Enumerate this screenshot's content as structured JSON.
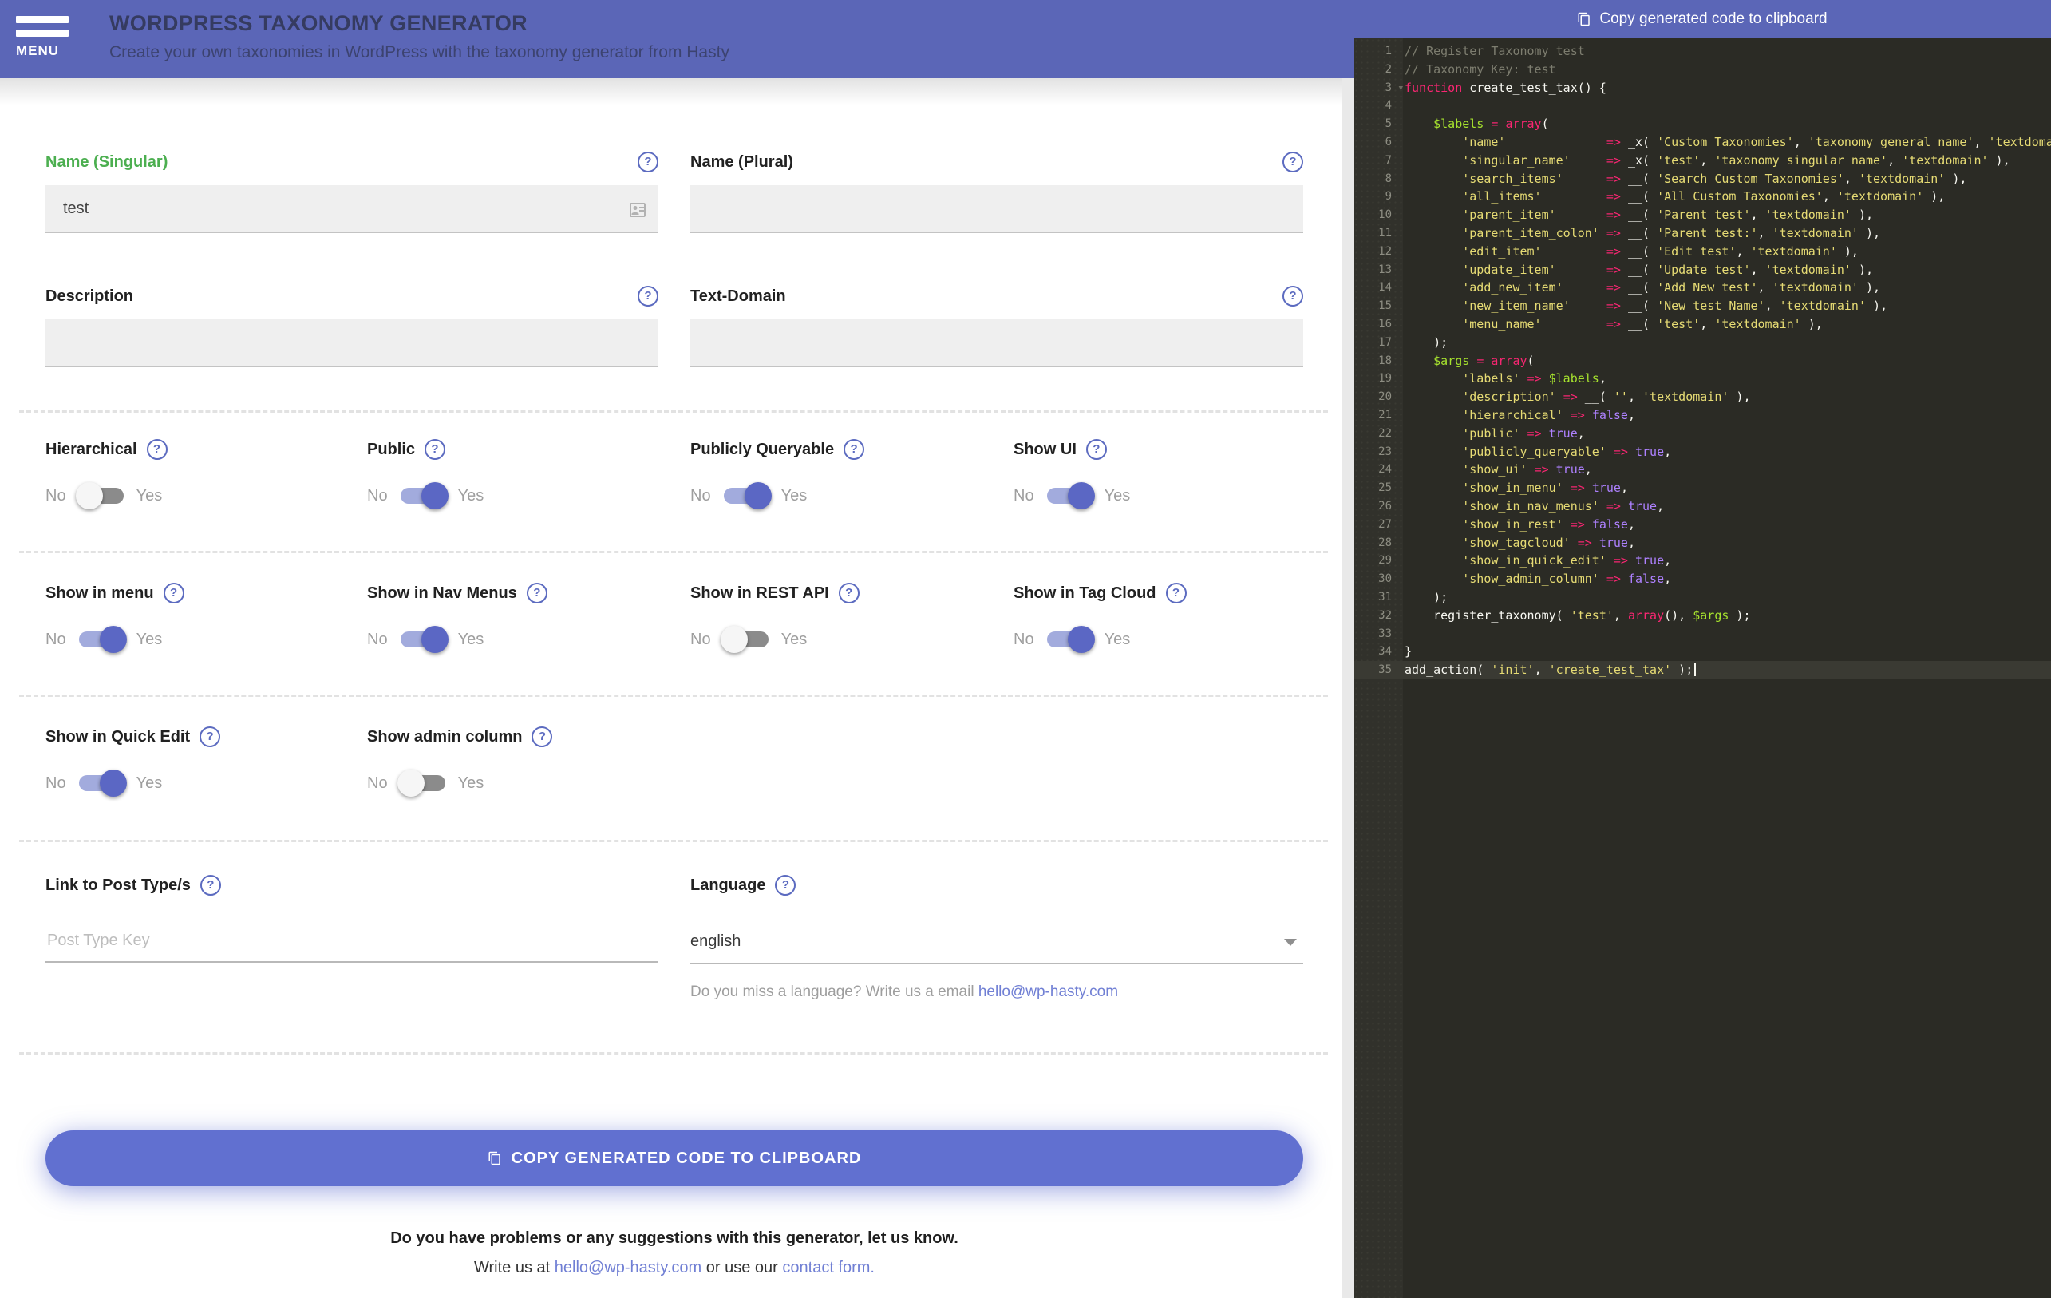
{
  "header": {
    "menu_label": "MENU",
    "title": "WORDPRESS TAXONOMY GENERATOR",
    "subtitle": "Create your own taxonomies in WordPress with the taxonomy generator from Hasty"
  },
  "form": {
    "fields": {
      "name_singular": {
        "label": "Name (Singular)",
        "value": "test"
      },
      "name_plural": {
        "label": "Name (Plural)",
        "value": ""
      },
      "description": {
        "label": "Description",
        "value": ""
      },
      "text_domain": {
        "label": "Text-Domain",
        "value": ""
      },
      "link_post_types": {
        "label": "Link to Post Type/s",
        "placeholder": "Post Type Key",
        "value": ""
      },
      "language": {
        "label": "Language",
        "value": "english",
        "helper_prefix": "Do you miss a language? Write us a email ",
        "helper_link": "hello@wp-hasty.com"
      }
    },
    "toggle_no": "No",
    "toggle_yes": "Yes",
    "toggles": [
      {
        "id": "hierarchical",
        "label": "Hierarchical",
        "state": "off"
      },
      {
        "id": "public",
        "label": "Public",
        "state": "on"
      },
      {
        "id": "publicly_queryable",
        "label": "Publicly Queryable",
        "state": "on"
      },
      {
        "id": "show_ui",
        "label": "Show UI",
        "state": "on"
      },
      {
        "id": "show_in_menu",
        "label": "Show in menu",
        "state": "on"
      },
      {
        "id": "show_in_nav_menus",
        "label": "Show in Nav Menus",
        "state": "on"
      },
      {
        "id": "show_in_rest_api",
        "label": "Show in REST API",
        "state": "off"
      },
      {
        "id": "show_in_tag_cloud",
        "label": "Show in Tag Cloud",
        "state": "on"
      },
      {
        "id": "show_in_quick_edit",
        "label": "Show in Quick Edit",
        "state": "on"
      },
      {
        "id": "show_admin_column",
        "label": "Show admin column",
        "state": "off"
      }
    ],
    "copy_button": "COPY GENERATED CODE TO CLIPBOARD"
  },
  "footer": {
    "line1": "Do you have problems or any suggestions with this generator, let us know.",
    "line2_prefix": "Write us at ",
    "line2_email": "hello@wp-hasty.com",
    "line2_middle": " or use our ",
    "line2_link": "contact form."
  },
  "code_panel": {
    "copy_label": "Copy generated code to clipboard",
    "current_line": 35,
    "fold_lines": [
      3
    ],
    "lines": [
      [
        [
          "cm",
          "// Register Taxonomy test"
        ]
      ],
      [
        [
          "cm",
          "// Taxonomy Key: test"
        ]
      ],
      [
        [
          "kw",
          "function"
        ],
        [
          "pl",
          " "
        ],
        [
          "fn",
          "create_test_tax"
        ],
        [
          "pl",
          "() {"
        ]
      ],
      [],
      [
        [
          "pl",
          "    "
        ],
        [
          "var",
          "$labels"
        ],
        [
          "pl",
          " "
        ],
        [
          "op",
          "="
        ],
        [
          "pl",
          " "
        ],
        [
          "op",
          "array"
        ],
        [
          "pl",
          "("
        ]
      ],
      [
        [
          "pl",
          "        "
        ],
        [
          "str",
          "'name'"
        ],
        [
          "pl",
          "              "
        ],
        [
          "op",
          "=>"
        ],
        [
          "pl",
          " "
        ],
        [
          "fn",
          "_x"
        ],
        [
          "pl",
          "( "
        ],
        [
          "str",
          "'Custom Taxonomies'"
        ],
        [
          "pl",
          ", "
        ],
        [
          "str",
          "'taxonomy general name'"
        ],
        [
          "pl",
          ", "
        ],
        [
          "str",
          "'textdomain'"
        ],
        [
          "pl",
          " ),"
        ]
      ],
      [
        [
          "pl",
          "        "
        ],
        [
          "str",
          "'singular_name'"
        ],
        [
          "pl",
          "     "
        ],
        [
          "op",
          "=>"
        ],
        [
          "pl",
          " "
        ],
        [
          "fn",
          "_x"
        ],
        [
          "pl",
          "( "
        ],
        [
          "str",
          "'test'"
        ],
        [
          "pl",
          ", "
        ],
        [
          "str",
          "'taxonomy singular name'"
        ],
        [
          "pl",
          ", "
        ],
        [
          "str",
          "'textdomain'"
        ],
        [
          "pl",
          " ),"
        ]
      ],
      [
        [
          "pl",
          "        "
        ],
        [
          "str",
          "'search_items'"
        ],
        [
          "pl",
          "      "
        ],
        [
          "op",
          "=>"
        ],
        [
          "pl",
          " "
        ],
        [
          "fn",
          "__"
        ],
        [
          "pl",
          "( "
        ],
        [
          "str",
          "'Search Custom Taxonomies'"
        ],
        [
          "pl",
          ", "
        ],
        [
          "str",
          "'textdomain'"
        ],
        [
          "pl",
          " ),"
        ]
      ],
      [
        [
          "pl",
          "        "
        ],
        [
          "str",
          "'all_items'"
        ],
        [
          "pl",
          "         "
        ],
        [
          "op",
          "=>"
        ],
        [
          "pl",
          " "
        ],
        [
          "fn",
          "__"
        ],
        [
          "pl",
          "( "
        ],
        [
          "str",
          "'All Custom Taxonomies'"
        ],
        [
          "pl",
          ", "
        ],
        [
          "str",
          "'textdomain'"
        ],
        [
          "pl",
          " ),"
        ]
      ],
      [
        [
          "pl",
          "        "
        ],
        [
          "str",
          "'parent_item'"
        ],
        [
          "pl",
          "       "
        ],
        [
          "op",
          "=>"
        ],
        [
          "pl",
          " "
        ],
        [
          "fn",
          "__"
        ],
        [
          "pl",
          "( "
        ],
        [
          "str",
          "'Parent test'"
        ],
        [
          "pl",
          ", "
        ],
        [
          "str",
          "'textdomain'"
        ],
        [
          "pl",
          " ),"
        ]
      ],
      [
        [
          "pl",
          "        "
        ],
        [
          "str",
          "'parent_item_colon'"
        ],
        [
          "pl",
          " "
        ],
        [
          "op",
          "=>"
        ],
        [
          "pl",
          " "
        ],
        [
          "fn",
          "__"
        ],
        [
          "pl",
          "( "
        ],
        [
          "str",
          "'Parent test:'"
        ],
        [
          "pl",
          ", "
        ],
        [
          "str",
          "'textdomain'"
        ],
        [
          "pl",
          " ),"
        ]
      ],
      [
        [
          "pl",
          "        "
        ],
        [
          "str",
          "'edit_item'"
        ],
        [
          "pl",
          "         "
        ],
        [
          "op",
          "=>"
        ],
        [
          "pl",
          " "
        ],
        [
          "fn",
          "__"
        ],
        [
          "pl",
          "( "
        ],
        [
          "str",
          "'Edit test'"
        ],
        [
          "pl",
          ", "
        ],
        [
          "str",
          "'textdomain'"
        ],
        [
          "pl",
          " ),"
        ]
      ],
      [
        [
          "pl",
          "        "
        ],
        [
          "str",
          "'update_item'"
        ],
        [
          "pl",
          "       "
        ],
        [
          "op",
          "=>"
        ],
        [
          "pl",
          " "
        ],
        [
          "fn",
          "__"
        ],
        [
          "pl",
          "( "
        ],
        [
          "str",
          "'Update test'"
        ],
        [
          "pl",
          ", "
        ],
        [
          "str",
          "'textdomain'"
        ],
        [
          "pl",
          " ),"
        ]
      ],
      [
        [
          "pl",
          "        "
        ],
        [
          "str",
          "'add_new_item'"
        ],
        [
          "pl",
          "      "
        ],
        [
          "op",
          "=>"
        ],
        [
          "pl",
          " "
        ],
        [
          "fn",
          "__"
        ],
        [
          "pl",
          "( "
        ],
        [
          "str",
          "'Add New test'"
        ],
        [
          "pl",
          ", "
        ],
        [
          "str",
          "'textdomain'"
        ],
        [
          "pl",
          " ),"
        ]
      ],
      [
        [
          "pl",
          "        "
        ],
        [
          "str",
          "'new_item_name'"
        ],
        [
          "pl",
          "     "
        ],
        [
          "op",
          "=>"
        ],
        [
          "pl",
          " "
        ],
        [
          "fn",
          "__"
        ],
        [
          "pl",
          "( "
        ],
        [
          "str",
          "'New test Name'"
        ],
        [
          "pl",
          ", "
        ],
        [
          "str",
          "'textdomain'"
        ],
        [
          "pl",
          " ),"
        ]
      ],
      [
        [
          "pl",
          "        "
        ],
        [
          "str",
          "'menu_name'"
        ],
        [
          "pl",
          "         "
        ],
        [
          "op",
          "=>"
        ],
        [
          "pl",
          " "
        ],
        [
          "fn",
          "__"
        ],
        [
          "pl",
          "( "
        ],
        [
          "str",
          "'test'"
        ],
        [
          "pl",
          ", "
        ],
        [
          "str",
          "'textdomain'"
        ],
        [
          "pl",
          " ),"
        ]
      ],
      [
        [
          "pl",
          "    );"
        ]
      ],
      [
        [
          "pl",
          "    "
        ],
        [
          "var",
          "$args"
        ],
        [
          "pl",
          " "
        ],
        [
          "op",
          "="
        ],
        [
          "pl",
          " "
        ],
        [
          "op",
          "array"
        ],
        [
          "pl",
          "("
        ]
      ],
      [
        [
          "pl",
          "        "
        ],
        [
          "str",
          "'labels'"
        ],
        [
          "pl",
          " "
        ],
        [
          "op",
          "=>"
        ],
        [
          "pl",
          " "
        ],
        [
          "var",
          "$labels"
        ],
        [
          "pl",
          ","
        ]
      ],
      [
        [
          "pl",
          "        "
        ],
        [
          "str",
          "'description'"
        ],
        [
          "pl",
          " "
        ],
        [
          "op",
          "=>"
        ],
        [
          "pl",
          " "
        ],
        [
          "fn",
          "__"
        ],
        [
          "pl",
          "( "
        ],
        [
          "str",
          "''"
        ],
        [
          "pl",
          ", "
        ],
        [
          "str",
          "'textdomain'"
        ],
        [
          "pl",
          " ),"
        ]
      ],
      [
        [
          "pl",
          "        "
        ],
        [
          "str",
          "'hierarchical'"
        ],
        [
          "pl",
          " "
        ],
        [
          "op",
          "=>"
        ],
        [
          "pl",
          " "
        ],
        [
          "bool",
          "false"
        ],
        [
          "pl",
          ","
        ]
      ],
      [
        [
          "pl",
          "        "
        ],
        [
          "str",
          "'public'"
        ],
        [
          "pl",
          " "
        ],
        [
          "op",
          "=>"
        ],
        [
          "pl",
          " "
        ],
        [
          "bool",
          "true"
        ],
        [
          "pl",
          ","
        ]
      ],
      [
        [
          "pl",
          "        "
        ],
        [
          "str",
          "'publicly_queryable'"
        ],
        [
          "pl",
          " "
        ],
        [
          "op",
          "=>"
        ],
        [
          "pl",
          " "
        ],
        [
          "bool",
          "true"
        ],
        [
          "pl",
          ","
        ]
      ],
      [
        [
          "pl",
          "        "
        ],
        [
          "str",
          "'show_ui'"
        ],
        [
          "pl",
          " "
        ],
        [
          "op",
          "=>"
        ],
        [
          "pl",
          " "
        ],
        [
          "bool",
          "true"
        ],
        [
          "pl",
          ","
        ]
      ],
      [
        [
          "pl",
          "        "
        ],
        [
          "str",
          "'show_in_menu'"
        ],
        [
          "pl",
          " "
        ],
        [
          "op",
          "=>"
        ],
        [
          "pl",
          " "
        ],
        [
          "bool",
          "true"
        ],
        [
          "pl",
          ","
        ]
      ],
      [
        [
          "pl",
          "        "
        ],
        [
          "str",
          "'show_in_nav_menus'"
        ],
        [
          "pl",
          " "
        ],
        [
          "op",
          "=>"
        ],
        [
          "pl",
          " "
        ],
        [
          "bool",
          "true"
        ],
        [
          "pl",
          ","
        ]
      ],
      [
        [
          "pl",
          "        "
        ],
        [
          "str",
          "'show_in_rest'"
        ],
        [
          "pl",
          " "
        ],
        [
          "op",
          "=>"
        ],
        [
          "pl",
          " "
        ],
        [
          "bool",
          "false"
        ],
        [
          "pl",
          ","
        ]
      ],
      [
        [
          "pl",
          "        "
        ],
        [
          "str",
          "'show_tagcloud'"
        ],
        [
          "pl",
          " "
        ],
        [
          "op",
          "=>"
        ],
        [
          "pl",
          " "
        ],
        [
          "bool",
          "true"
        ],
        [
          "pl",
          ","
        ]
      ],
      [
        [
          "pl",
          "        "
        ],
        [
          "str",
          "'show_in_quick_edit'"
        ],
        [
          "pl",
          " "
        ],
        [
          "op",
          "=>"
        ],
        [
          "pl",
          " "
        ],
        [
          "bool",
          "true"
        ],
        [
          "pl",
          ","
        ]
      ],
      [
        [
          "pl",
          "        "
        ],
        [
          "str",
          "'show_admin_column'"
        ],
        [
          "pl",
          " "
        ],
        [
          "op",
          "=>"
        ],
        [
          "pl",
          " "
        ],
        [
          "bool",
          "false"
        ],
        [
          "pl",
          ","
        ]
      ],
      [
        [
          "pl",
          "    );"
        ]
      ],
      [
        [
          "pl",
          "    "
        ],
        [
          "fn",
          "register_taxonomy"
        ],
        [
          "pl",
          "( "
        ],
        [
          "str",
          "'test'"
        ],
        [
          "pl",
          ", "
        ],
        [
          "op",
          "array"
        ],
        [
          "pl",
          "(), "
        ],
        [
          "var",
          "$args"
        ],
        [
          "pl",
          " );"
        ]
      ],
      [],
      [
        [
          "pl",
          "}"
        ]
      ],
      [
        [
          "fn",
          "add_action"
        ],
        [
          "pl",
          "( "
        ],
        [
          "str",
          "'init'"
        ],
        [
          "pl",
          ", "
        ],
        [
          "str",
          "'create_test_tax'"
        ],
        [
          "pl",
          " );"
        ]
      ]
    ]
  },
  "icons": {
    "menu-icon": "hamburger bars",
    "help-icon": "? in circle",
    "copy-icon": "two stacked sheets",
    "contact-autofill-icon": "id card",
    "dropdown-arrow-icon": "▼",
    "fold-arrow-icon": "▼"
  },
  "colors": {
    "accent": "#5c6bc0",
    "header_bg": "#5b66b7",
    "button_bg": "#6170d0",
    "label_filled_green": "#4caf50",
    "editor_bg": "#2b2b25",
    "code_comment": "#7d7d6f",
    "code_keyword": "#f92672",
    "code_string": "#e6db74",
    "code_variable": "#a6e22e",
    "code_boolean": "#ae81ff",
    "code_text": "#f8f8f2"
  }
}
